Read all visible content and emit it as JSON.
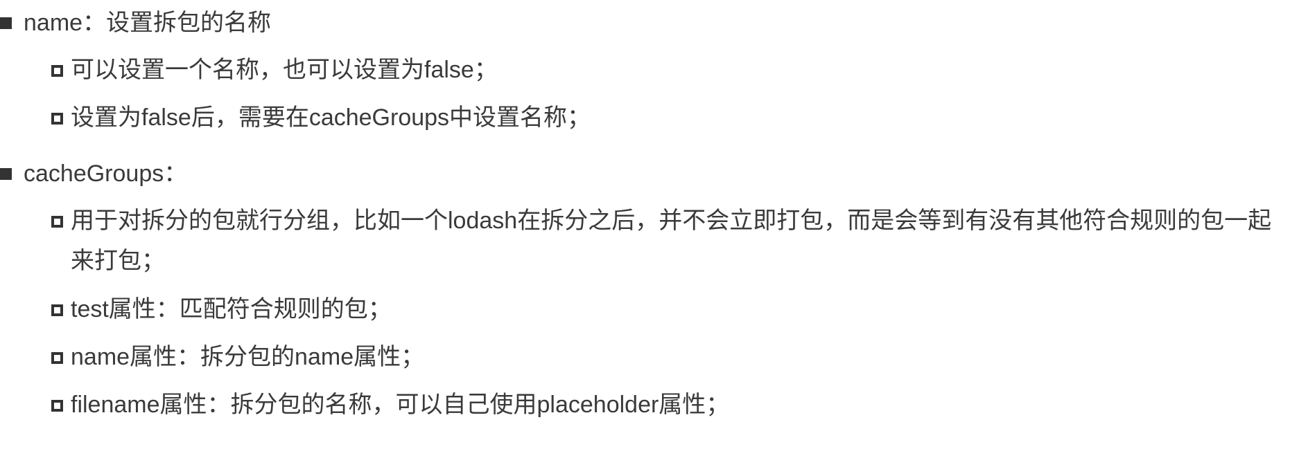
{
  "items": [
    {
      "level": 1,
      "text": "name：设置拆包的名称"
    },
    {
      "level": 2,
      "text": "可以设置一个名称，也可以设置为false；"
    },
    {
      "level": 2,
      "text": "设置为false后，需要在cacheGroups中设置名称；"
    },
    {
      "level": 1,
      "text": "cacheGroups："
    },
    {
      "level": 2,
      "text": "用于对拆分的包就行分组，比如一个lodash在拆分之后，并不会立即打包，而是会等到有没有其他符合规则的包一起来打包；"
    },
    {
      "level": 2,
      "text": "test属性：匹配符合规则的包；"
    },
    {
      "level": 2,
      "text": "name属性：拆分包的name属性；"
    },
    {
      "level": 2,
      "text": "filename属性：拆分包的名称，可以自己使用placeholder属性；"
    }
  ]
}
